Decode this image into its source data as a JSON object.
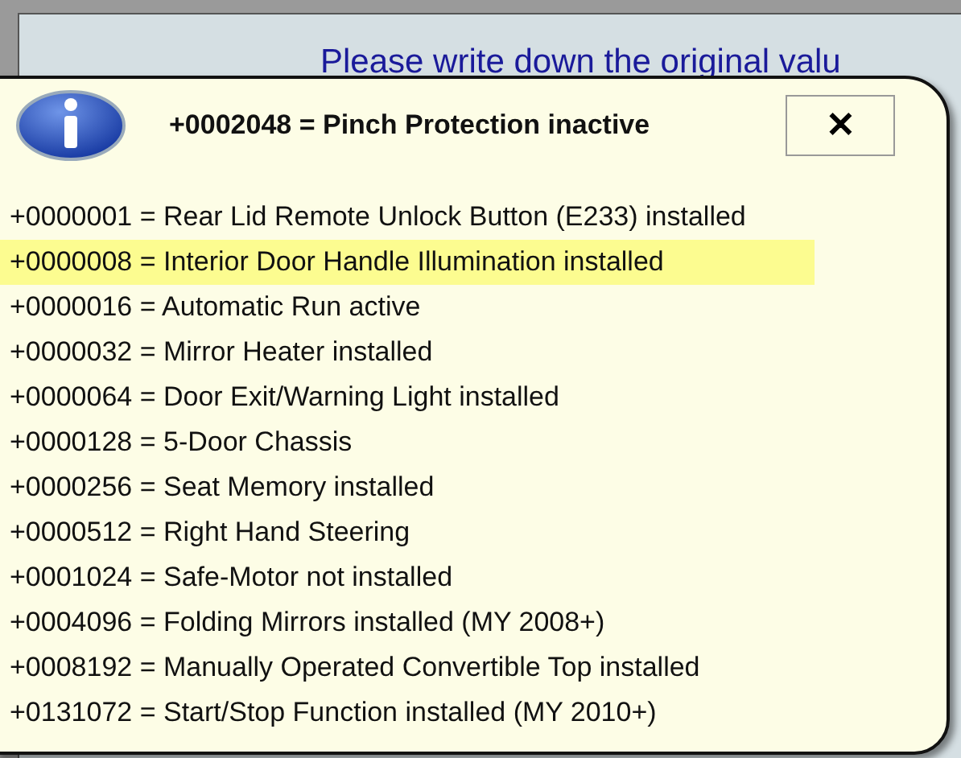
{
  "background": {
    "instruction": "Please write down the original valu"
  },
  "balloon": {
    "title": "+0002048 = Pinch Protection inactive",
    "close": "✕",
    "items": [
      {
        "text": "+0000001 = Rear Lid Remote Unlock Button (E233) installed",
        "selected": false
      },
      {
        "text": "+0000008 = Interior Door Handle Illumination installed",
        "selected": true
      },
      {
        "text": "+0000016 = Automatic Run active",
        "selected": false
      },
      {
        "text": "+0000032 = Mirror Heater installed",
        "selected": false
      },
      {
        "text": "+0000064 = Door Exit/Warning Light installed",
        "selected": false
      },
      {
        "text": "+0000128 = 5-Door Chassis",
        "selected": false
      },
      {
        "text": "+0000256 = Seat Memory installed",
        "selected": false
      },
      {
        "text": "+0000512 = Right Hand Steering",
        "selected": false
      },
      {
        "text": "+0001024 = Safe-Motor not installed",
        "selected": false
      },
      {
        "text": "+0004096 = Folding Mirrors installed (MY 2008+)",
        "selected": false
      },
      {
        "text": "+0008192 = Manually Operated Convertible Top installed",
        "selected": false
      },
      {
        "text": "+0131072 = Start/Stop Function installed (MY 2010+)",
        "selected": false
      }
    ]
  }
}
